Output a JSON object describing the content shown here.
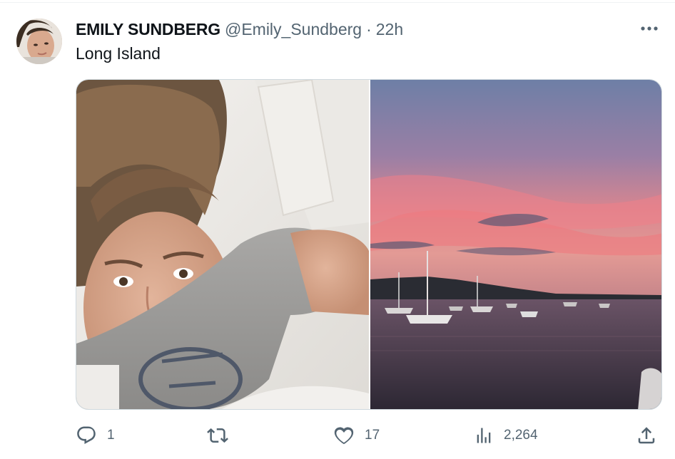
{
  "tweet": {
    "display_name": "EMILY SUNDBERG",
    "handle": "@Emily_Sundberg",
    "separator": "·",
    "time": "22h",
    "text": "Long Island"
  },
  "media": [
    {
      "icon": "selfie-photo"
    },
    {
      "icon": "sunset-harbor-photo"
    }
  ],
  "actions": {
    "reply_count": "1",
    "retweet_count": "",
    "like_count": "17",
    "view_count": "2,264"
  },
  "colors": {
    "text": "#0f1419",
    "secondary": "#536471",
    "border": "#cfd9de"
  }
}
